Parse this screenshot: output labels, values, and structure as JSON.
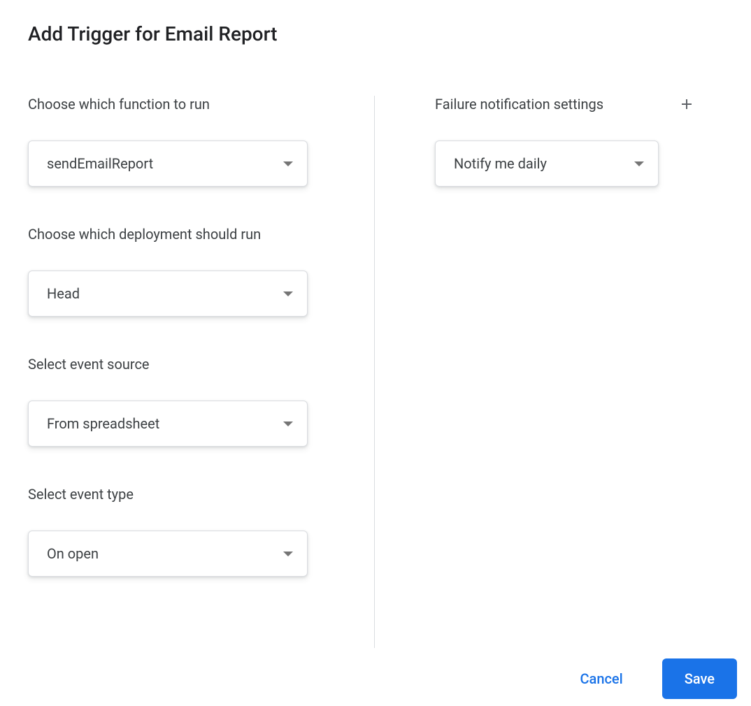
{
  "title": "Add Trigger for Email Report",
  "left": {
    "function": {
      "label": "Choose which function to run",
      "value": "sendEmailReport"
    },
    "deployment": {
      "label": "Choose which deployment should run",
      "value": "Head"
    },
    "eventSource": {
      "label": "Select event source",
      "value": "From spreadsheet"
    },
    "eventType": {
      "label": "Select event type",
      "value": "On open"
    }
  },
  "right": {
    "failureHeader": "Failure notification settings",
    "notify": {
      "value": "Notify me daily"
    }
  },
  "footer": {
    "cancel": "Cancel",
    "save": "Save"
  }
}
